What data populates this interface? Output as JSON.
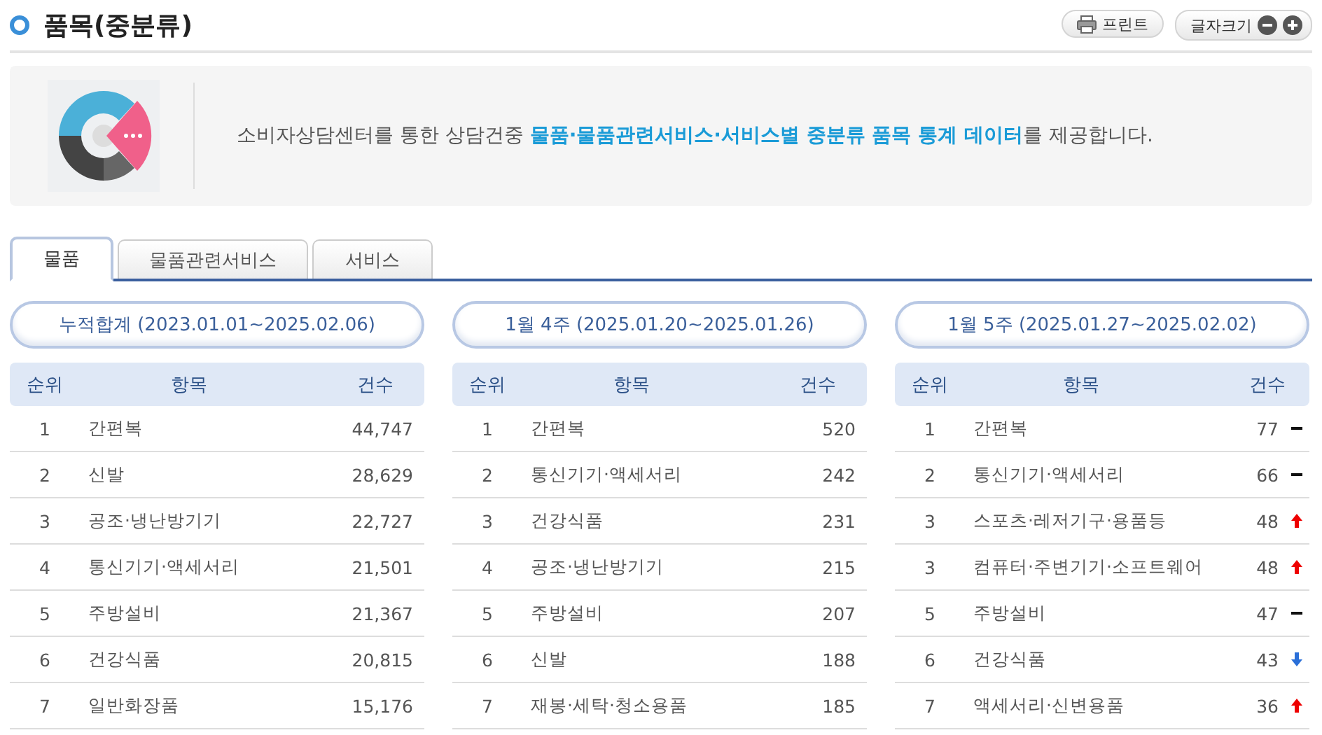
{
  "page_title": "품목(중분류)",
  "toolbar": [
    {
      "kind": "print",
      "label": "프린트"
    },
    {
      "kind": "font_size",
      "label": "글자크기"
    }
  ],
  "intro": {
    "text": "소비자상담센터를 통한 상담건중 **물품·물품관련서비스·서비스별 중분류 품목 통계 데이터**를 제공합니다."
  },
  "tabs": [
    {
      "label": "물품",
      "selected": true
    },
    {
      "label": "물품관련서비스",
      "selected": false
    },
    {
      "label": "서비스",
      "selected": false
    }
  ],
  "panels": [
    {
      "period": "누적합계 (2023.01.01~2025.02.06)",
      "columns": [
        "순위",
        "항목",
        "건수"
      ],
      "rows": [
        {
          "rank": "1",
          "item": "간편복",
          "count": "44,747"
        },
        {
          "rank": "2",
          "item": "신발",
          "count": "28,629"
        },
        {
          "rank": "3",
          "item": "공조·냉난방기기",
          "count": "22,727"
        },
        {
          "rank": "4",
          "item": "통신기기·액세서리",
          "count": "21,501"
        },
        {
          "rank": "5",
          "item": "주방설비",
          "count": "21,367"
        },
        {
          "rank": "6",
          "item": "건강식품",
          "count": "20,815"
        },
        {
          "rank": "7",
          "item": "일반화장품",
          "count": "15,176"
        }
      ]
    },
    {
      "period": "1월 4주 (2025.01.20~2025.01.26)",
      "columns": [
        "순위",
        "항목",
        "건수"
      ],
      "rows": [
        {
          "rank": "1",
          "item": "간편복",
          "count": "520"
        },
        {
          "rank": "2",
          "item": "통신기기·액세서리",
          "count": "242"
        },
        {
          "rank": "3",
          "item": "건강식품",
          "count": "231"
        },
        {
          "rank": "4",
          "item": "공조·냉난방기기",
          "count": "215"
        },
        {
          "rank": "5",
          "item": "주방설비",
          "count": "207"
        },
        {
          "rank": "6",
          "item": "신발",
          "count": "188"
        },
        {
          "rank": "7",
          "item": "재봉·세탁·청소용품",
          "count": "185"
        }
      ]
    },
    {
      "period": "1월 5주 (2025.01.27~2025.02.02)",
      "columns": [
        "순위",
        "항목",
        "건수"
      ],
      "rows": [
        {
          "rank": "1",
          "item": "간편복",
          "count": "77",
          "kind": "same"
        },
        {
          "rank": "2",
          "item": "통신기기·액세서리",
          "count": "66",
          "kind": "same"
        },
        {
          "rank": "3",
          "item": "스포츠·레저기구·용품등",
          "count": "48",
          "kind": "up"
        },
        {
          "rank": "3",
          "item": "컴퓨터·주변기기·소프트웨어",
          "count": "48",
          "kind": "up"
        },
        {
          "rank": "5",
          "item": "주방설비",
          "count": "47",
          "kind": "same"
        },
        {
          "rank": "6",
          "item": "건강식품",
          "count": "43",
          "kind": "down"
        },
        {
          "rank": "7",
          "item": "액세서리·신변용품",
          "count": "36",
          "kind": "up"
        }
      ]
    }
  ]
}
